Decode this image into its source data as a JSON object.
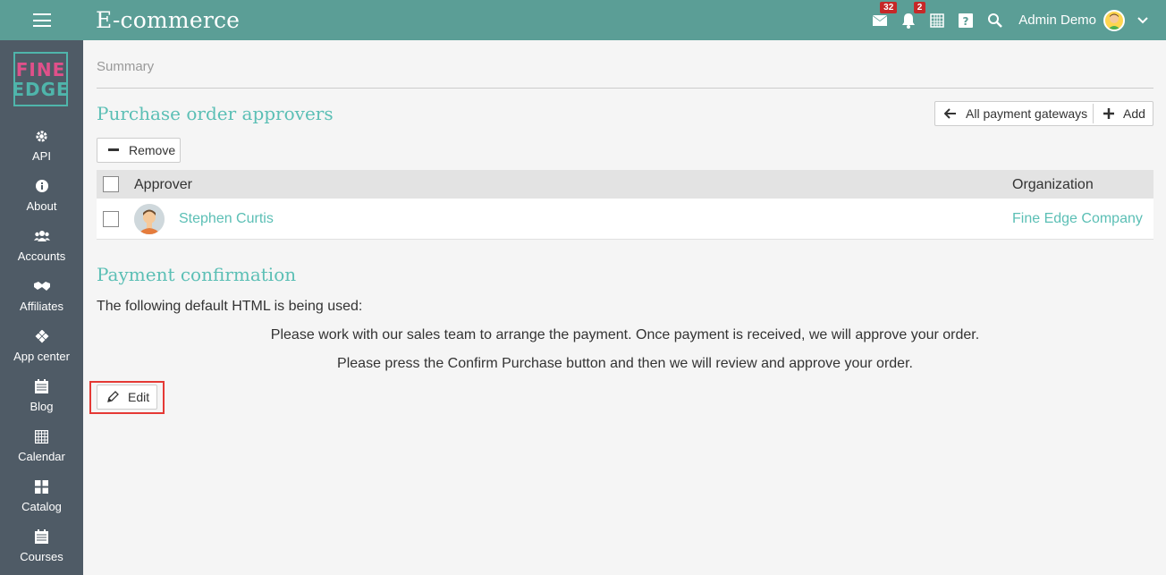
{
  "header": {
    "title": "E-commerce",
    "mail_badge": "32",
    "notif_badge": "2",
    "user_name": "Admin Demo"
  },
  "sidebar": {
    "logo_line1": "FINE",
    "logo_line2": "EDGE",
    "items": [
      {
        "label": "API",
        "icon": "gear-icon"
      },
      {
        "label": "About",
        "icon": "info-icon"
      },
      {
        "label": "Accounts",
        "icon": "users-icon"
      },
      {
        "label": "Affiliates",
        "icon": "handshake-icon"
      },
      {
        "label": "App center",
        "icon": "app-center-icon"
      },
      {
        "label": "Blog",
        "icon": "blog-icon"
      },
      {
        "label": "Calendar",
        "icon": "calendar-icon"
      },
      {
        "label": "Catalog",
        "icon": "grid-icon"
      },
      {
        "label": "Courses",
        "icon": "courses-icon"
      }
    ]
  },
  "main": {
    "breadcrumb": "Summary",
    "approvers": {
      "title": "Purchase order approvers",
      "all_gateways_label": "All payment gateways",
      "add_label": "Add",
      "remove_label": "Remove",
      "columns": {
        "approver": "Approver",
        "organization": "Organization"
      },
      "rows": [
        {
          "approver": "Stephen Curtis",
          "organization": "Fine Edge Company"
        }
      ]
    },
    "payment": {
      "title": "Payment confirmation",
      "intro": "The following default HTML is being used:",
      "line1": "Please work with our sales team to arrange the payment. Once payment is received, we will approve your order.",
      "line2": "Please press the Confirm Purchase button and then we will review and approve your order.",
      "edit_label": "Edit"
    }
  },
  "colors": {
    "topbar": "#5b9e96",
    "sidebar": "#4f5b66",
    "accent": "#5bbfb5",
    "badge": "#c62828",
    "highlight": "#e53935"
  }
}
